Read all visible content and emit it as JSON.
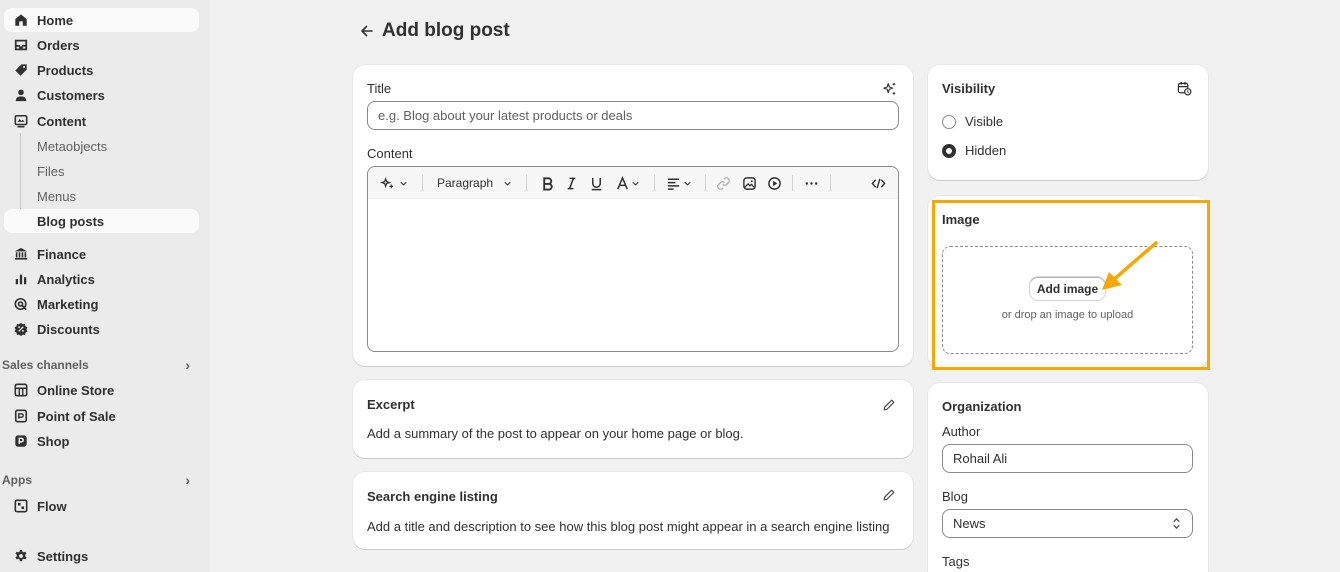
{
  "nav": {
    "home": "Home",
    "orders": "Orders",
    "products": "Products",
    "customers": "Customers",
    "content": "Content",
    "content_sub": [
      "Metaobjects",
      "Files",
      "Menus",
      "Blog posts"
    ],
    "finance": "Finance",
    "analytics": "Analytics",
    "marketing": "Marketing",
    "discounts": "Discounts",
    "sales_channels_label": "Sales channels",
    "online_store": "Online Store",
    "point_of_sale": "Point of Sale",
    "shop": "Shop",
    "apps_label": "Apps",
    "flow": "Flow",
    "settings": "Settings"
  },
  "page": {
    "title": "Add blog post"
  },
  "title_card": {
    "title_label": "Title",
    "title_placeholder": "e.g. Blog about your latest products or deals",
    "content_label": "Content",
    "paragraph_select": "Paragraph"
  },
  "excerpt": {
    "title": "Excerpt",
    "description": "Add a summary of the post to appear on your home page or blog."
  },
  "seo": {
    "title": "Search engine listing",
    "description": "Add a title and description to see how this blog post might appear in a search engine listing"
  },
  "visibility": {
    "title": "Visibility",
    "options": [
      "Visible",
      "Hidden"
    ],
    "selected": "Hidden"
  },
  "image": {
    "title": "Image",
    "add_button": "Add image",
    "drop_hint": "or drop an image to upload"
  },
  "organization": {
    "title": "Organization",
    "author_label": "Author",
    "author_value": "Rohail Ali",
    "blog_label": "Blog",
    "blog_value": "News",
    "tags_label": "Tags"
  },
  "colors": {
    "highlight": "#f5a800",
    "arrow": "#f5a800"
  },
  "icons": {
    "nav": [
      "home-icon",
      "orders-icon",
      "tag-icon",
      "person-icon",
      "content-icon",
      "bank-icon",
      "bar-chart-icon",
      "target-icon",
      "discount-icon",
      "store-icon",
      "pos-icon",
      "shop-icon",
      "flow-icon",
      "gear-icon"
    ],
    "toolbar": [
      "magic-icon",
      "chevron-down-icon",
      "bold-icon",
      "italic-icon",
      "underline-icon",
      "text-color-icon",
      "align-icon",
      "link-icon",
      "image-icon",
      "video-icon",
      "more-icon",
      "code-icon"
    ],
    "other": [
      "back-arrow-icon",
      "sparkle-icon",
      "pencil-icon",
      "calendar-clock-icon",
      "select-chevron-icon",
      "annotation-arrow-icon"
    ]
  }
}
